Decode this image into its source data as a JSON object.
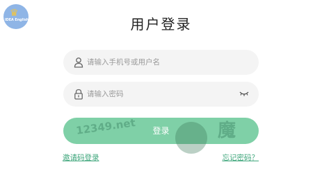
{
  "logo": {
    "brand": "IDEA English"
  },
  "page": {
    "title": "用户登录"
  },
  "form": {
    "username_placeholder": "请输入手机号或用户名",
    "password_placeholder": "请输入密码",
    "login_label": "登录"
  },
  "links": {
    "invite": "邀请码登录",
    "forgot": "忘记密码？"
  },
  "watermark": {
    "site": "12349.net",
    "char": "魔"
  },
  "colors": {
    "accent": "#7fd0a7",
    "link": "#3ea67b"
  }
}
